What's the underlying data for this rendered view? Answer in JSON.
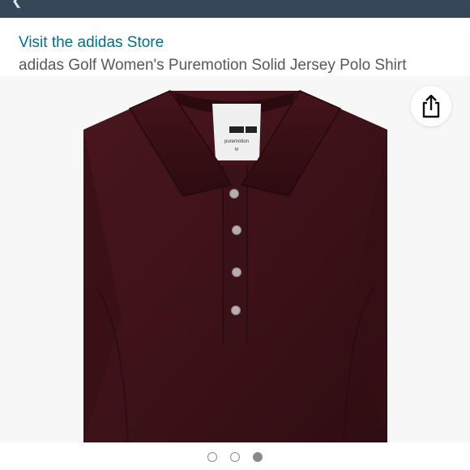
{
  "header": {
    "store_link": "Visit the adidas Store",
    "product_title": "adidas Golf Women's Puremotion Solid Jersey Polo Shirt"
  },
  "product_image": {
    "shirt_color": "#3d1218",
    "background_color": "#f7f7f7",
    "label_brand_text": "puremotion",
    "label_size_text": "M"
  },
  "share": {
    "icon": "share-icon"
  },
  "carousel": {
    "total": 3,
    "active_index": 2
  },
  "colors": {
    "topbar": "#37475a",
    "link": "#007185",
    "title": "#565959"
  }
}
